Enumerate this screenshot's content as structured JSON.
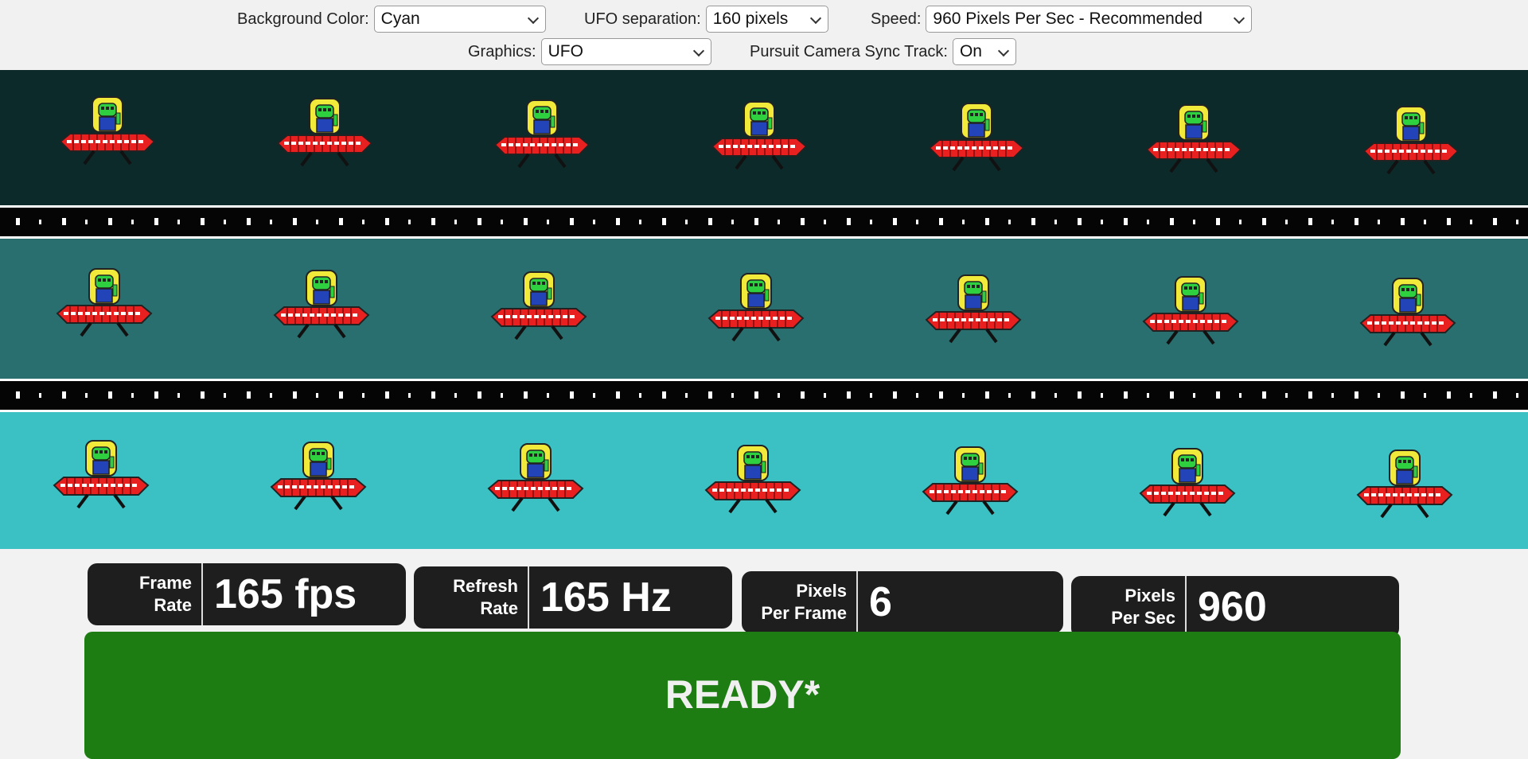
{
  "controls": {
    "background_color": {
      "label": "Background Color:",
      "value": "Cyan"
    },
    "ufo_separation": {
      "label": "UFO separation:",
      "value": "160 pixels"
    },
    "speed": {
      "label": "Speed:",
      "value": "960 Pixels Per Sec - Recommended"
    },
    "graphics": {
      "label": "Graphics:",
      "value": "UFO"
    },
    "pursuit_camera": {
      "label": "Pursuit Camera Sync Track:",
      "value": "On"
    }
  },
  "lanes": [
    {
      "name": "dark",
      "color": "#0d2a2b"
    },
    {
      "name": "medium",
      "color": "#2a6f6f"
    },
    {
      "name": "light",
      "color": "#3bc1c3"
    }
  ],
  "ufos_per_lane": 7,
  "ufo_colors": {
    "saucer": "#e8201f",
    "dome": "#f2ea3a",
    "alien": "#2fd040",
    "body": "#2343b8",
    "legs": "#111111"
  },
  "stats": {
    "frame_rate": {
      "label_line1": "Frame",
      "label_line2": "Rate",
      "value": "165 fps"
    },
    "refresh_rate": {
      "label_line1": "Refresh",
      "label_line2": "Rate",
      "value": "165 Hz"
    },
    "pixels_per_frame": {
      "label_line1": "Pixels",
      "label_line2": "Per Frame",
      "value": "6"
    },
    "pixels_per_sec": {
      "label_line1": "Pixels",
      "label_line2": "Per Sec",
      "value": "960"
    }
  },
  "status": {
    "text": "READY*",
    "color": "#1d7d12"
  }
}
